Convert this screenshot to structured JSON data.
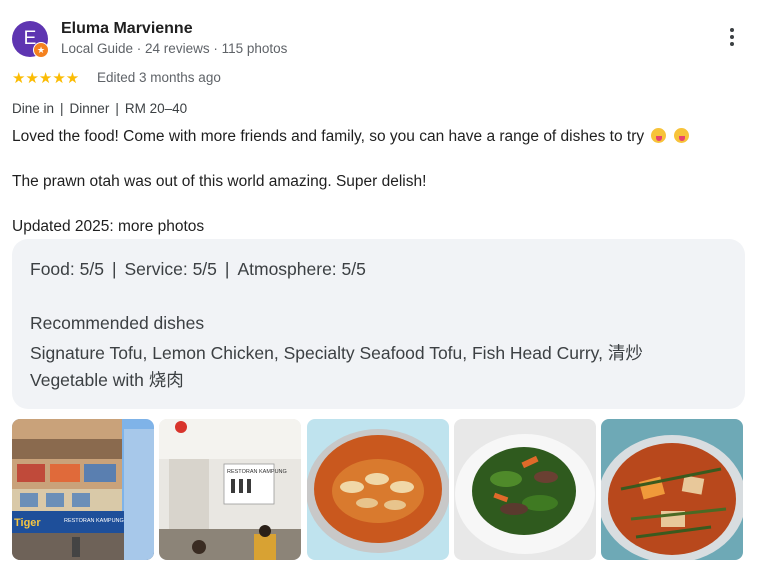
{
  "reviewer": {
    "initial": "E",
    "name": "Eluma Marvienne",
    "meta": "Local Guide · 24 reviews · 115 photos",
    "avatar_color": "#5e35b1",
    "badge_color": "#f4811f"
  },
  "menu": {
    "icon": "more-vert-icon"
  },
  "rating": {
    "stars": 5,
    "star_glyphs": "★★★★★",
    "edited": "Edited 3 months ago"
  },
  "attributes": [
    "Dine in",
    "Dinner",
    "RM 20–40"
  ],
  "attribute_separator": "|",
  "review": {
    "paragraph1": "Loved the food! Come with more friends and family, so you can have a range of dishes to try",
    "paragraph2": "The prawn otah was out of this world amazing. Super delish!",
    "paragraph3": "Updated 2025: more photos"
  },
  "ratings_box": {
    "food": "Food: 5/5",
    "service": "Service: 5/5",
    "atmosphere": "Atmosphere: 5/5",
    "separator": "|",
    "recommended_heading": "Recommended dishes",
    "recommended_line1": "Signature Tofu, Lemon Chicken, Specialty Seafood Tofu, Fish Head Curry, 清炒",
    "recommended_line2": "Vegetable with 烧肉"
  },
  "photos": [
    {
      "name": "restaurant-exterior-photo",
      "sign_text": "RESTORAN KAMPUNG WAWU"
    },
    {
      "name": "restaurant-interior-photo",
      "sign_text": "RESTORAN KAMPUNG"
    },
    {
      "name": "prawn-dish-photo"
    },
    {
      "name": "vegetable-dish-photo"
    },
    {
      "name": "curry-dish-photo"
    }
  ]
}
